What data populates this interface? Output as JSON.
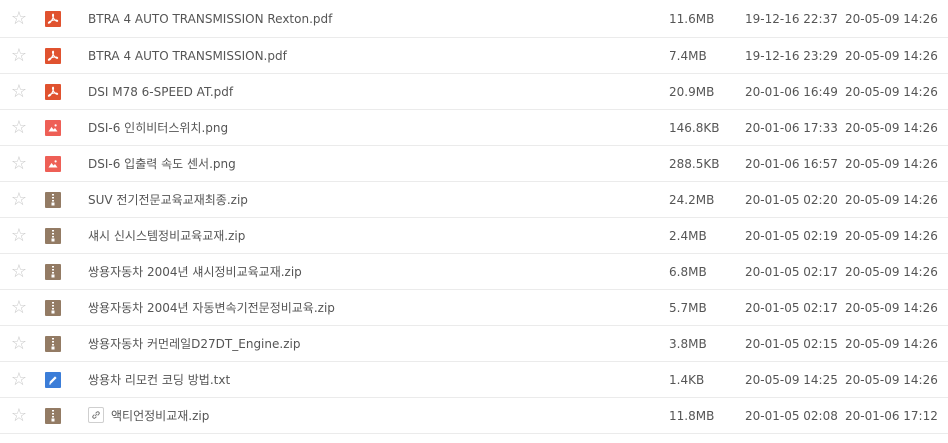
{
  "files": [
    {
      "name": "BTRA 4 AUTO TRANSMISSION Rexton.pdf",
      "type": "pdf",
      "icon": "pdf-file-icon",
      "size": "11.6MB",
      "date1": "19-12-16 22:37",
      "date2": "20-05-09 14:26"
    },
    {
      "name": "BTRA 4 AUTO TRANSMISSION.pdf",
      "type": "pdf",
      "icon": "pdf-file-icon",
      "size": "7.4MB",
      "date1": "19-12-16 23:29",
      "date2": "20-05-09 14:26"
    },
    {
      "name": "DSI M78 6-SPEED AT.pdf",
      "type": "pdf",
      "icon": "pdf-file-icon",
      "size": "20.9MB",
      "date1": "20-01-06 16:49",
      "date2": "20-05-09 14:26"
    },
    {
      "name": "DSI-6 인히비터스위치.png",
      "type": "png",
      "icon": "image-file-icon",
      "size": "146.8KB",
      "date1": "20-01-06 17:33",
      "date2": "20-05-09 14:26"
    },
    {
      "name": "DSI-6 입출력 속도 센서.png",
      "type": "png",
      "icon": "image-file-icon",
      "size": "288.5KB",
      "date1": "20-01-06 16:57",
      "date2": "20-05-09 14:26"
    },
    {
      "name": "SUV 전기전문교육교재최종.zip",
      "type": "zip",
      "icon": "zip-file-icon",
      "size": "24.2MB",
      "date1": "20-01-05 02:20",
      "date2": "20-05-09 14:26"
    },
    {
      "name": "섀시 신시스템정비교육교재.zip",
      "type": "zip",
      "icon": "zip-file-icon",
      "size": "2.4MB",
      "date1": "20-01-05 02:19",
      "date2": "20-05-09 14:26"
    },
    {
      "name": "쌍용자동차 2004년 섀시정비교육교재.zip",
      "type": "zip",
      "icon": "zip-file-icon",
      "size": "6.8MB",
      "date1": "20-01-05 02:17",
      "date2": "20-05-09 14:26"
    },
    {
      "name": "쌍용자동차 2004년 자동변속기전문정비교육.zip",
      "type": "zip",
      "icon": "zip-file-icon",
      "size": "5.7MB",
      "date1": "20-01-05 02:17",
      "date2": "20-05-09 14:26"
    },
    {
      "name": "쌍용자동차 커먼레일D27DT_Engine.zip",
      "type": "zip",
      "icon": "zip-file-icon",
      "size": "3.8MB",
      "date1": "20-01-05 02:15",
      "date2": "20-05-09 14:26"
    },
    {
      "name": "쌍용차 리모컨 코딩 방법.txt",
      "type": "txt",
      "icon": "text-file-icon",
      "size": "1.4KB",
      "date1": "20-05-09 14:25",
      "date2": "20-05-09 14:26"
    },
    {
      "name": "액티언정비교재.zip",
      "type": "zip",
      "icon": "zip-file-icon",
      "size": "11.8MB",
      "date1": "20-01-05 02:08",
      "date2": "20-01-06 17:12",
      "shared_link": true
    }
  ],
  "colors": {
    "pdf": "#e0522f",
    "png": "#ee5f56",
    "zip": "#937b64",
    "txt": "#3b7dd8",
    "star": "#c9c9c9",
    "text": "#555555",
    "divider": "#ebebeb"
  },
  "star_glyph": "☆"
}
